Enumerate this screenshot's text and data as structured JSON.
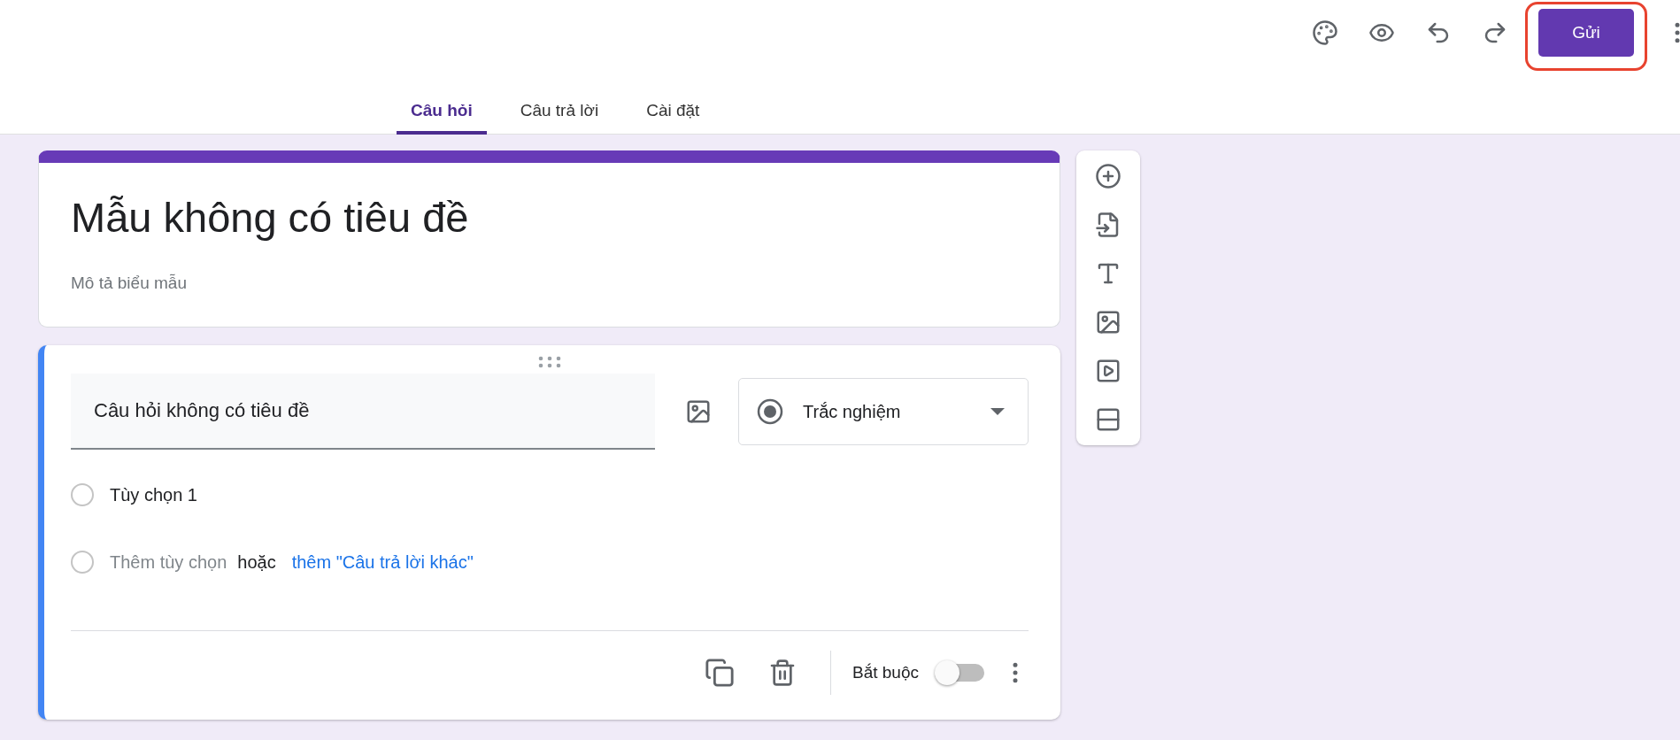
{
  "send_button": {
    "label": "Gửi",
    "highlighted": true
  },
  "tabs": [
    {
      "label": "Câu hỏi",
      "selected": true
    },
    {
      "label": "Câu trả lời",
      "selected": false
    },
    {
      "label": "Cài đặt",
      "selected": false
    }
  ],
  "form_header": {
    "title": "Mẫu không có tiêu đề",
    "description_placeholder": "Mô tả biểu mẫu"
  },
  "question": {
    "title": "Câu hỏi không có tiêu đề",
    "type": "Trắc nghiệm",
    "options": [
      {
        "label": "Tùy chọn 1",
        "selected": false
      }
    ],
    "add_option": {
      "selected": false,
      "placeholder": "Thêm tùy chọn",
      "separator": "hoặc",
      "link": "thêm \"Câu trả lời khác\""
    },
    "required_label": "Bắt buộc",
    "required": false
  }
}
